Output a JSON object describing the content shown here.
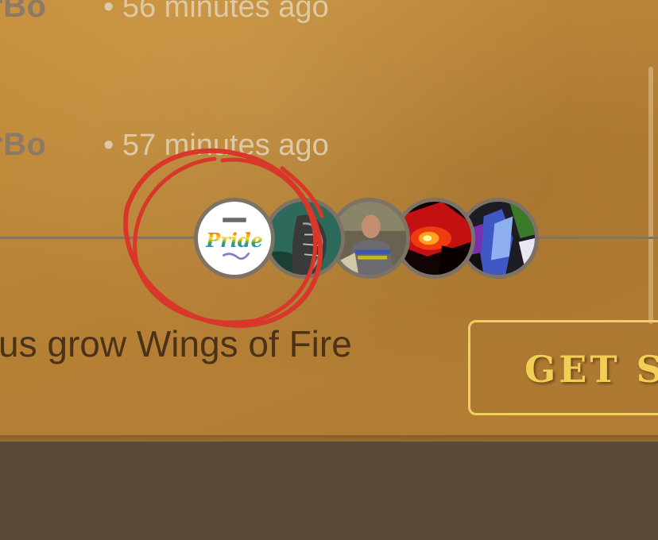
{
  "messages": [
    {
      "author": "rBo",
      "time": "• 56 minutes ago"
    },
    {
      "author": "rBo",
      "time": "• 57 minutes ago"
    }
  ],
  "participants": [
    {
      "icon": "pride-logo-avatar",
      "logo_text": "Pride"
    },
    {
      "icon": "dragon-avatar"
    },
    {
      "icon": "person-photo-avatar"
    },
    {
      "icon": "fire-avatar"
    },
    {
      "icon": "blue-dragon-avatar"
    }
  ],
  "tagline": "us grow Wings of Fire",
  "cta": {
    "label": "GET ST"
  },
  "colors": {
    "panel": "#b98336",
    "annotation_circle": "#d8382a",
    "cta_border": "#efd05e",
    "cta_text": "#f1cf55",
    "bottom_bar": "#5a4b37"
  }
}
